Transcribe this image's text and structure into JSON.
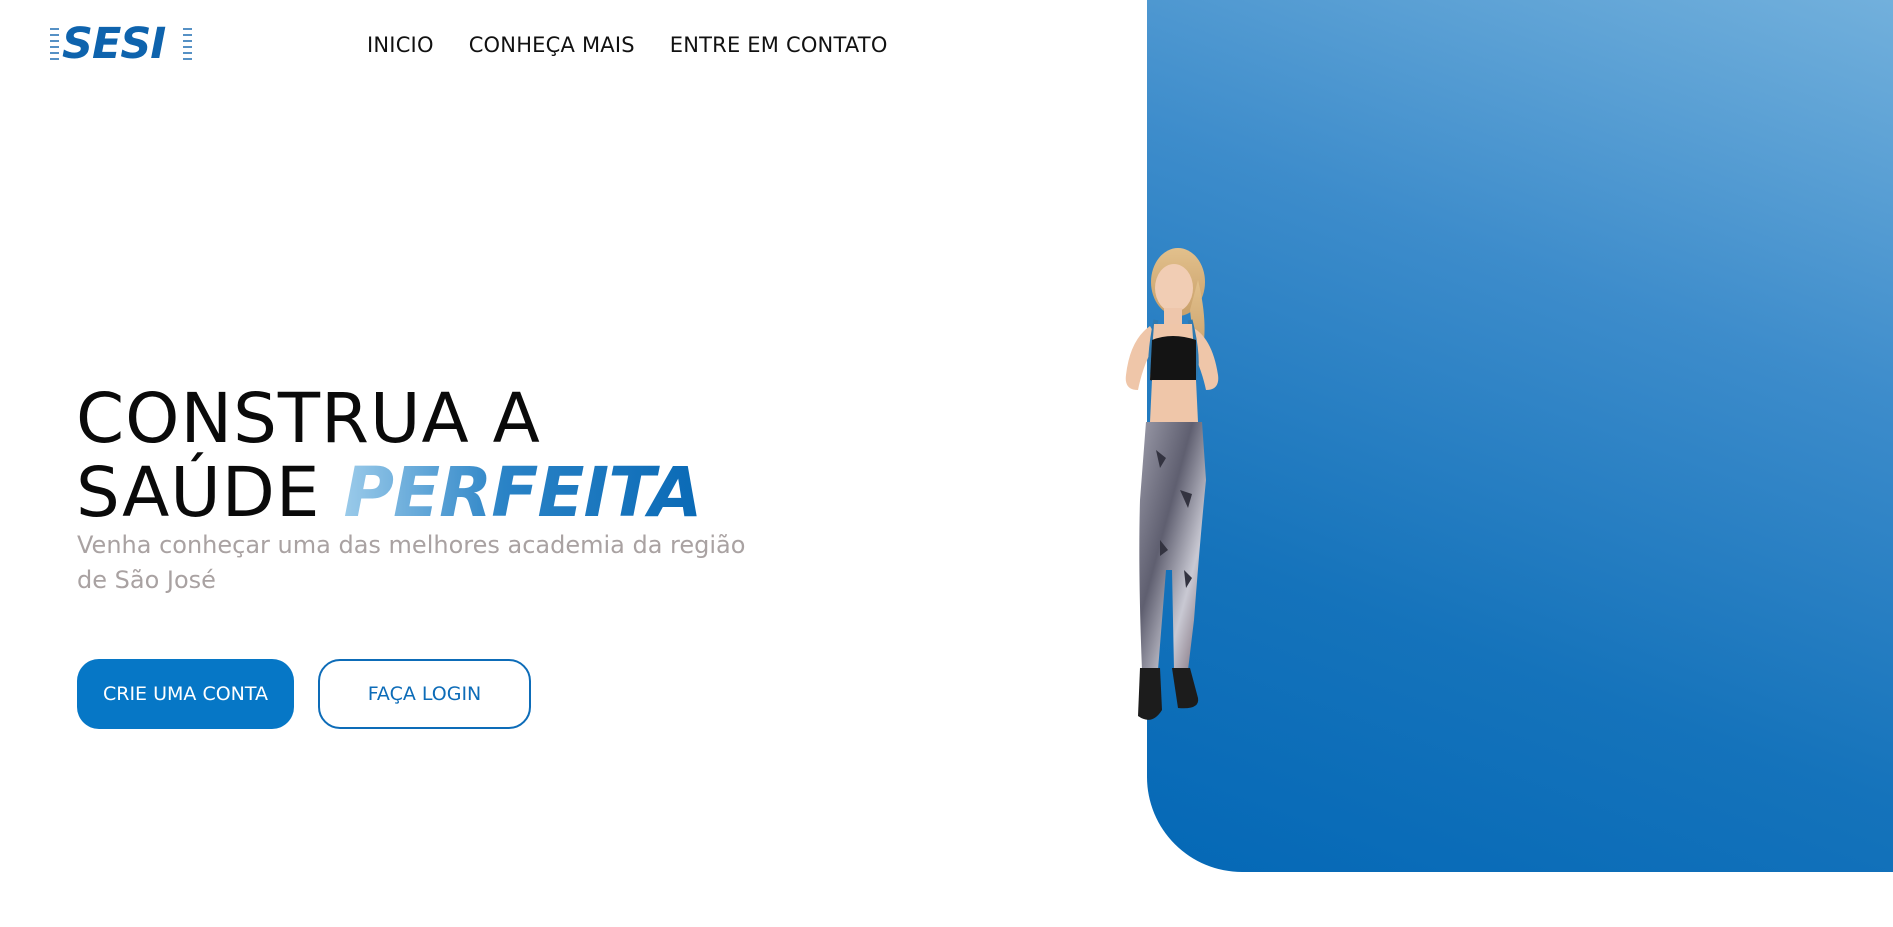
{
  "logo": {
    "text": "SESI"
  },
  "nav": {
    "items": [
      {
        "label": "INICIO"
      },
      {
        "label": "CONHEÇA MAIS"
      },
      {
        "label": "ENTRE EM CONTATO"
      }
    ]
  },
  "hero": {
    "title_line1": "CONSTRUA A",
    "title_line2_prefix": "SAÚDE ",
    "title_accent": "PERFEITA",
    "subtitle": "Venha conheçar uma das melhores academia da região de São José",
    "primary_button": "CRIE UMA CONTA",
    "secondary_button": "FAÇA LOGIN"
  },
  "colors": {
    "brand_blue": "#0677c6",
    "panel_gradient_light": "#72b0dc",
    "panel_gradient_dark": "#0468b6",
    "subtitle_gray": "#a9a2a2"
  }
}
